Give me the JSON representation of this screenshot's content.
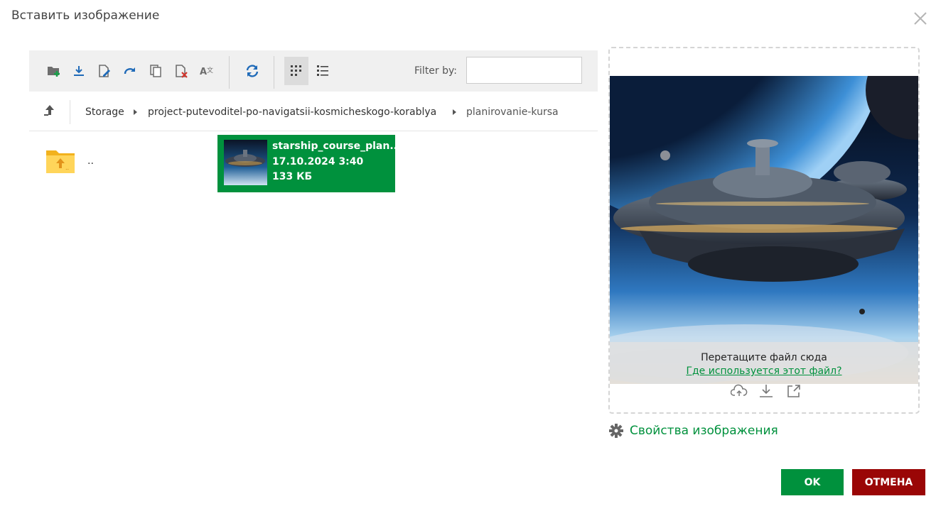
{
  "dialog": {
    "title": "Вставить изображение",
    "close_icon": "close-icon"
  },
  "toolbar": {
    "icons": [
      "new-folder-icon",
      "download-icon",
      "rename-icon",
      "redo-icon",
      "copy-icon",
      "delete-icon",
      "translit-icon",
      "refresh-icon",
      "grid-view-icon",
      "list-view-icon"
    ],
    "active_view": "grid-view",
    "filter_label": "Filter by:",
    "filter_value": ""
  },
  "breadcrumb": {
    "items": [
      "Storage",
      "project-putevoditel-po-navigatsii-kosmicheskogo-korablya",
      "planirovanie-kursa"
    ]
  },
  "files": {
    "parent_label": "..",
    "selected": {
      "name": "starship_course_plan...",
      "date": "17.10.2024 3:40",
      "size": "133 КБ"
    }
  },
  "preview": {
    "drop_text": "Перетащите файл сюда",
    "usage_link": "Где используется этот файл?",
    "actions": [
      "upload-cloud-icon",
      "download-icon",
      "open-external-icon"
    ]
  },
  "image_properties": {
    "label": "Свойства изображения"
  },
  "buttons": {
    "ok": "OK",
    "cancel": "ОТМЕНА"
  },
  "colors": {
    "accent": "#00913d",
    "cancel": "#9a0606",
    "toolbar_bg": "#f0f0f0"
  }
}
